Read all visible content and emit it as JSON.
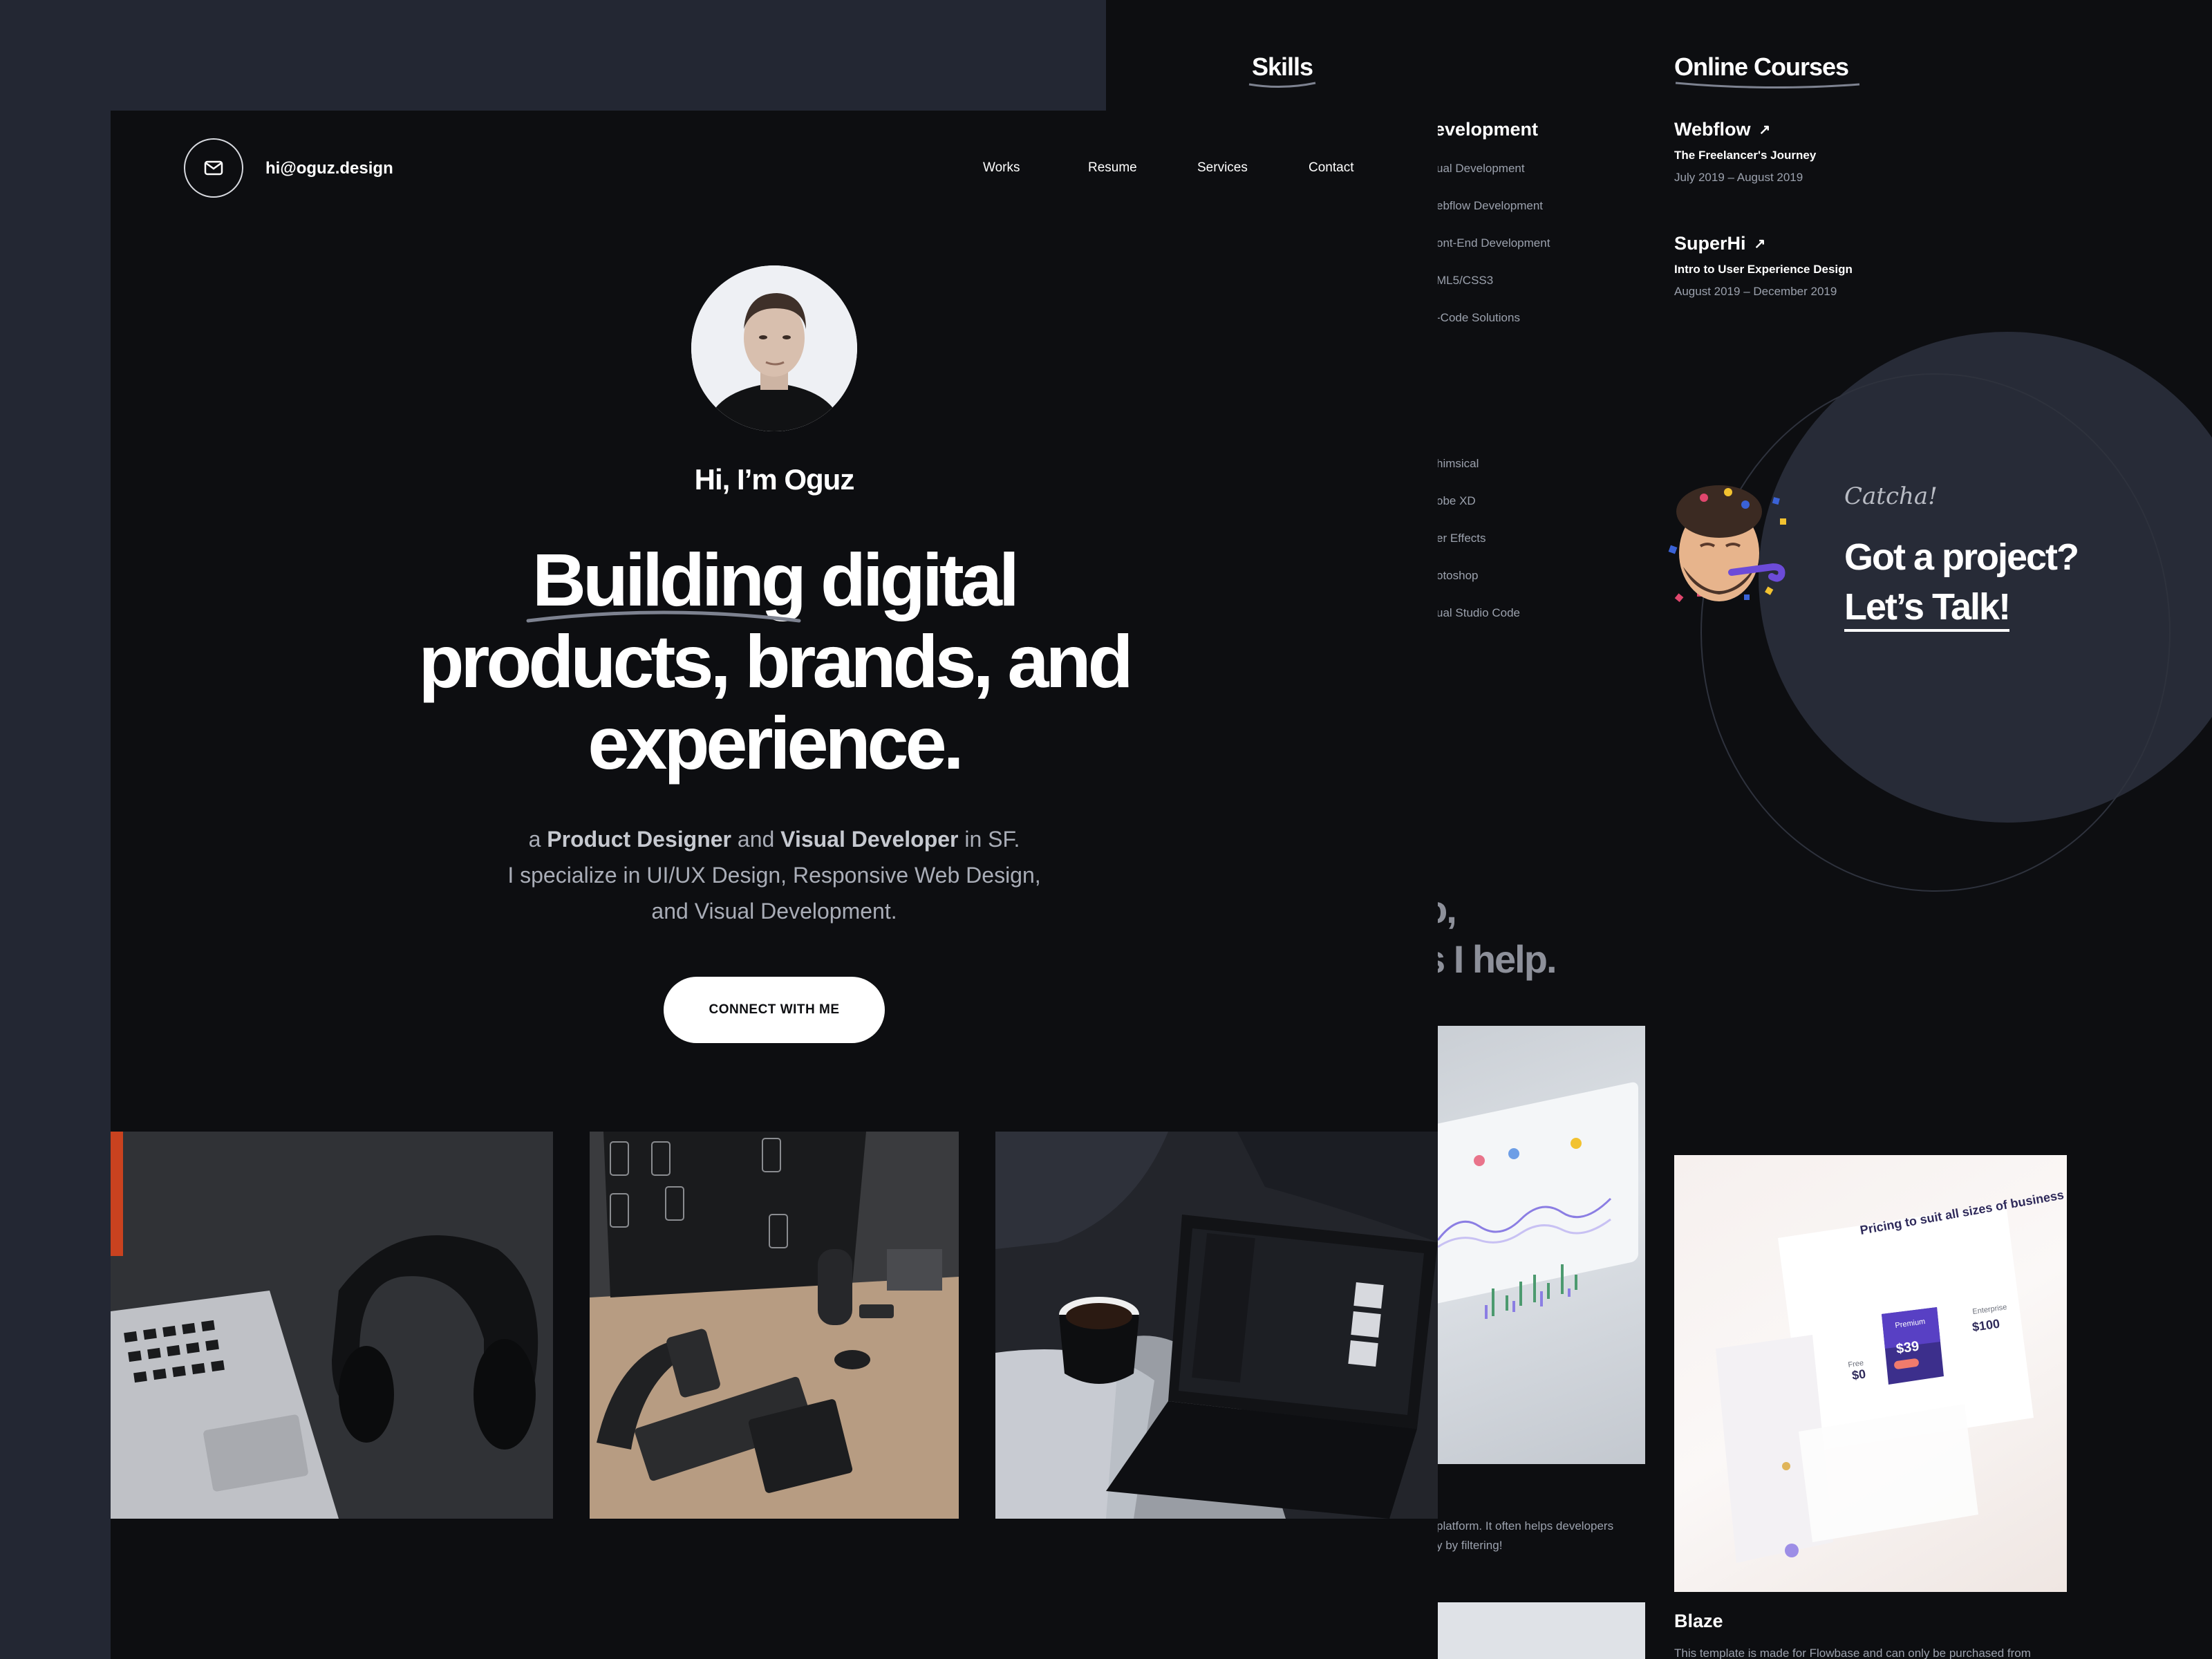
{
  "header": {
    "email": "hi@oguz.design",
    "nav": [
      "Works",
      "Resume",
      "Services",
      "Contact"
    ]
  },
  "hero": {
    "greeting": "Hi, I’m Oguz",
    "headline_line1": "Building digital",
    "headline_line2": "products, brands, and",
    "headline_line3": "experience.",
    "intro_a": "a ",
    "intro_role1": "Product Designer",
    "intro_and": " and ",
    "intro_role2": "Visual Developer",
    "intro_location": " in SF.",
    "intro_line2": "I specialize in UI/UX Design, Responsive Web Design,",
    "intro_line3": "and Visual Development.",
    "cta": "CONNECT WITH ME"
  },
  "skills": {
    "heading": "Skills",
    "dev_heading": "evelopment",
    "dev_items": [
      "ual Development",
      "ebflow Development",
      "ont-End Development",
      "ML5/CSS3",
      "-Code Solutions"
    ],
    "tools_items": [
      "himsical",
      "obe XD",
      "er Effects",
      "otoshop",
      "ual Studio Code"
    ]
  },
  "courses": {
    "heading": "Online Courses",
    "items": [
      {
        "name": "Webflow",
        "subtitle": "The Freelancer's Journey",
        "dates": "July 2019 – August 2019"
      },
      {
        "name": "SuperHi",
        "subtitle": "Intro to User Experience Design",
        "dates": "August 2019 – December 2019"
      }
    ]
  },
  "contact_cta": {
    "script": "Catcha!",
    "title": "Got a project?",
    "link": "Let’s Talk!"
  },
  "services_teaser": {
    "line1": "o,",
    "line2": "s I help."
  },
  "projects": {
    "left_desc_1": "platform. It often helps developers",
    "left_desc_2": "y by filtering!",
    "right_title": "Blaze",
    "right_desc": "This template is made for Flowbase and can only be purchased from",
    "pricing_title": "Pricing to suit all sizes of business",
    "price_free": "$0",
    "price_pro": "$39",
    "price_ent": "$100",
    "label_free": "Free",
    "label_pro": "Premium",
    "label_ent": "Enterprise"
  },
  "colors": {
    "outer_bg": "#232733",
    "page_bg": "#0d0e11",
    "cta_circle": "#272b37",
    "muted_text": "#9ba1ad",
    "accent_white": "#ffffff"
  }
}
